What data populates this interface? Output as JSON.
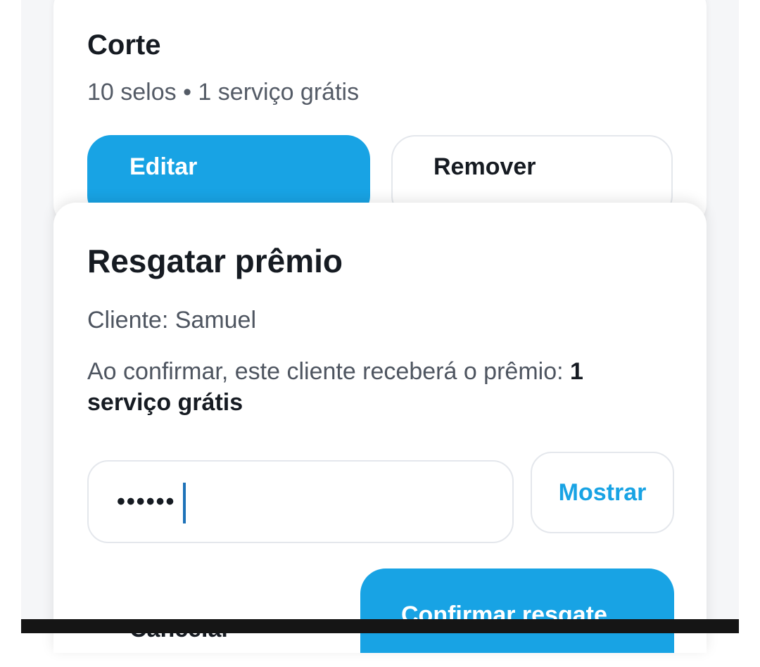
{
  "service_card": {
    "title": "Corte",
    "meta": "10 selos • 1 serviço grátis",
    "edit_label": "Editar",
    "remove_label": "Remover"
  },
  "redeem_dialog": {
    "title": "Resgatar prêmio",
    "client_line": "Cliente: Samuel",
    "confirm_prefix": "Ao confirmar, este cliente receberá o prêmio: ",
    "reward": "1 serviço grátis",
    "password_value": "••••••",
    "show_label": "Mostrar",
    "cancel_label": "Cancelar",
    "confirm_label": "Confirmar resgate"
  },
  "colors": {
    "primary": "#18a3e4",
    "text": "#161b22",
    "muted": "#4e5560",
    "border": "#e4e7ec"
  }
}
